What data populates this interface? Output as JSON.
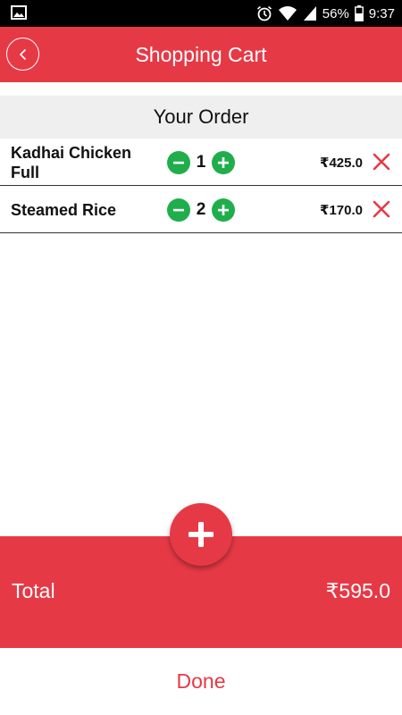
{
  "status_bar": {
    "battery": "56%",
    "time": "9:37",
    "icons": [
      "image-icon",
      "alarm-icon",
      "wifi-icon",
      "signal-icon",
      "battery-icon"
    ]
  },
  "header": {
    "title": "Shopping Cart",
    "back_icon": "chevron-left-icon"
  },
  "order": {
    "title": "Your Order",
    "items": [
      {
        "name": "Kadhai Chicken Full",
        "quantity": "1",
        "price": "₹425.0"
      },
      {
        "name": "Steamed Rice",
        "quantity": "2",
        "price": "₹170.0"
      }
    ]
  },
  "fab": {
    "icon": "plus-icon"
  },
  "total": {
    "label": "Total",
    "value": "₹595.0"
  },
  "done": {
    "label": "Done"
  },
  "colors": {
    "accent": "#e63946",
    "qty_button": "#1fae4b",
    "section_bg": "#efefef"
  }
}
